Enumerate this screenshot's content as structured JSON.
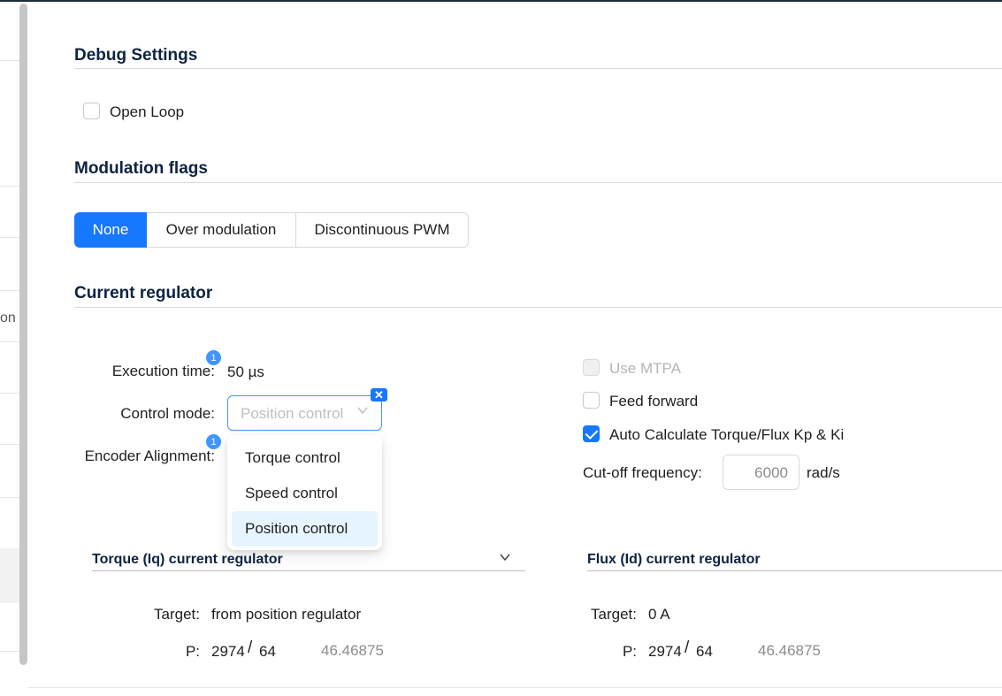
{
  "left_fragment": "on",
  "debug": {
    "title": "Debug Settings",
    "open_loop_label": "Open Loop"
  },
  "modulation": {
    "title": "Modulation flags",
    "options": [
      "None",
      "Over modulation",
      "Discontinuous PWM"
    ],
    "selected": "None"
  },
  "current_regulator": {
    "title": "Current regulator",
    "execution_time_label": "Execution time:",
    "execution_time_badge": "1",
    "execution_time_value": "50 µs",
    "control_mode_label": "Control mode:",
    "control_mode_placeholder": "Position control",
    "encoder_alignment_label": "Encoder Alignment:",
    "encoder_alignment_badge": "1",
    "dropdown_options": [
      "Torque control",
      "Speed control",
      "Position control"
    ],
    "dropdown_selected": "Position control",
    "clear_icon": "close-icon",
    "use_mtpa_label": "Use MTPA",
    "feed_forward_label": "Feed forward",
    "auto_calc_label": "Auto Calculate Torque/Flux Kp & Ki",
    "cutoff_label": "Cut-off frequency:",
    "cutoff_value": "6000",
    "cutoff_unit": "rad/s"
  },
  "torque_panel": {
    "title": "Torque (Iq) current regulator",
    "target_label": "Target:",
    "target_value": "from position regulator",
    "p_label": "P:",
    "p_numerator": "2974",
    "p_slash": "/",
    "p_denominator": "64",
    "p_result": "46.46875"
  },
  "flux_panel": {
    "title": "Flux (Id) current regulator",
    "target_label": "Target:",
    "target_value": "0 A",
    "p_label": "P:",
    "p_numerator": "2974",
    "p_slash": "/",
    "p_denominator": "64",
    "p_result": "46.46875"
  },
  "colors": {
    "accent": "#1677ff",
    "heading": "#0d2341",
    "selected_option_bg": "#e6f4ff"
  }
}
